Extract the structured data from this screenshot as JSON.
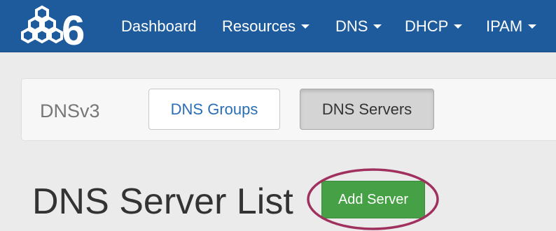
{
  "nav": {
    "logo_text": "6",
    "items": [
      {
        "label": "Dashboard",
        "dropdown": false
      },
      {
        "label": "Resources",
        "dropdown": true
      },
      {
        "label": "DNS",
        "dropdown": true
      },
      {
        "label": "DHCP",
        "dropdown": true
      },
      {
        "label": "IPAM",
        "dropdown": true
      }
    ]
  },
  "subnav": {
    "brand": "DNSv3",
    "tabs": [
      {
        "label": "DNS Groups",
        "active": false
      },
      {
        "label": "DNS Servers",
        "active": true
      }
    ]
  },
  "main": {
    "title": "DNS Server List",
    "add_button_label": "Add Server"
  },
  "colors": {
    "nav_bg": "#1e5b9c",
    "link_blue": "#2a6eb5",
    "success_green": "#46a046",
    "highlight_ring": "#a0305e"
  },
  "annotation": {
    "highlight": "add-server-button"
  }
}
